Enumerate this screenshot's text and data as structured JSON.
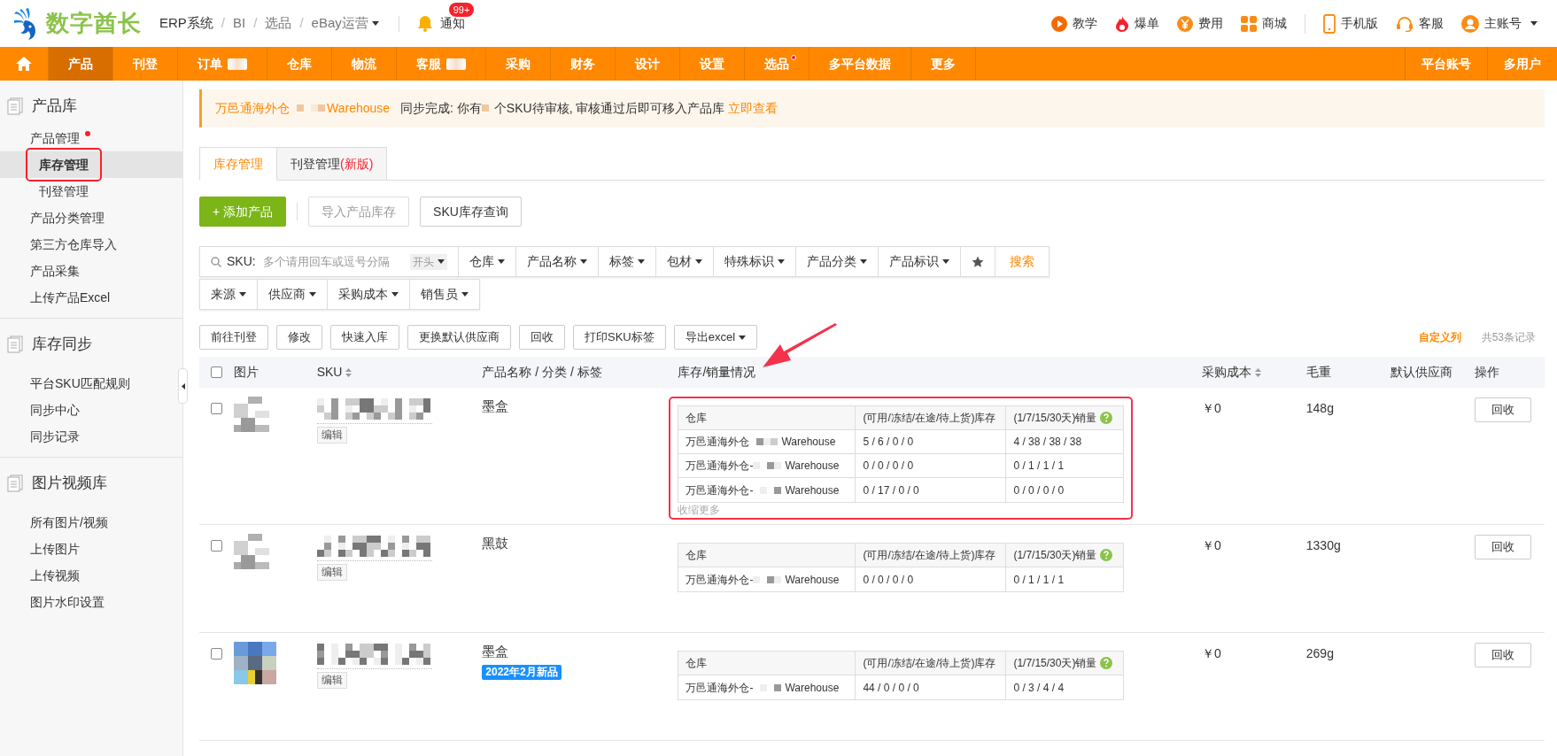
{
  "header": {
    "logo_text": "数字酋长",
    "breadcrumbs": [
      {
        "label": "ERP系统",
        "kind": "link"
      },
      {
        "label": "/",
        "kind": "separator"
      },
      {
        "label": "BI",
        "kind": "link"
      },
      {
        "label": "/",
        "kind": "separator"
      },
      {
        "label": "选品",
        "kind": "link"
      },
      {
        "label": "/",
        "kind": "separator"
      },
      {
        "label": "eBay运营",
        "kind": "link"
      }
    ],
    "notice": "通知",
    "notice_badge": "99+",
    "links": [
      {
        "label": "教学",
        "kind": "play"
      },
      {
        "label": "爆单",
        "kind": "fire"
      },
      {
        "label": "费用",
        "kind": "yen"
      },
      {
        "label": "商城",
        "kind": "grid"
      },
      {
        "label": "手机版",
        "kind": "phone"
      },
      {
        "label": "客服",
        "kind": "headset"
      },
      {
        "label": "主账号",
        "kind": "user"
      }
    ]
  },
  "nav": {
    "items": [
      {
        "label": "产品",
        "selected": true,
        "dot": false,
        "badge": false
      },
      {
        "label": "刊登",
        "selected": false,
        "dot": false,
        "badge": false
      },
      {
        "label": "订单",
        "selected": false,
        "dot": false,
        "badge": true
      },
      {
        "label": "仓库",
        "selected": false,
        "dot": false,
        "badge": false
      },
      {
        "label": "物流",
        "selected": false,
        "dot": false,
        "badge": false
      },
      {
        "label": "客服",
        "selected": false,
        "dot": false,
        "badge": true
      },
      {
        "label": "采购",
        "selected": false,
        "dot": false,
        "badge": false
      },
      {
        "label": "财务",
        "selected": false,
        "dot": false,
        "badge": false
      },
      {
        "label": "设计",
        "selected": false,
        "dot": false,
        "badge": false
      },
      {
        "label": "设置",
        "selected": false,
        "dot": false,
        "badge": false
      },
      {
        "label": "选品",
        "selected": false,
        "dot": true,
        "badge": false
      },
      {
        "label": "多平台数据",
        "selected": false,
        "dot": false,
        "badge": false
      },
      {
        "label": "更多",
        "selected": false,
        "dot": false,
        "badge": false
      }
    ],
    "right_items": [
      "平台账号",
      "多用户"
    ]
  },
  "sidebar": [
    {
      "title": "产品库",
      "items": [
        {
          "label": "产品管理",
          "dot": true,
          "selected": false,
          "highlighted": false,
          "children": [
            {
              "label": "库存管理",
              "dot": false,
              "selected": true,
              "highlighted": true
            },
            {
              "label": "刊登管理",
              "dot": false,
              "selected": false,
              "highlighted": false
            }
          ]
        },
        {
          "label": "产品分类管理",
          "dot": false,
          "selected": false,
          "highlighted": false
        },
        {
          "label": "第三方仓库导入",
          "dot": false,
          "selected": false,
          "highlighted": false
        },
        {
          "label": "产品采集",
          "dot": false,
          "selected": false,
          "highlighted": false
        },
        {
          "label": "上传产品Excel",
          "dot": false,
          "selected": false,
          "highlighted": false
        }
      ]
    },
    {
      "title": "库存同步",
      "items": [
        {
          "label": "平台SKU匹配规则",
          "dot": false,
          "selected": false,
          "highlighted": false
        },
        {
          "label": "同步中心",
          "dot": false,
          "selected": false,
          "highlighted": false
        },
        {
          "label": "同步记录",
          "dot": false,
          "selected": false,
          "highlighted": false
        }
      ]
    },
    {
      "title": "图片视频库",
      "items": [
        {
          "label": "所有图片/视频",
          "dot": false,
          "selected": false,
          "highlighted": false
        },
        {
          "label": "上传图片",
          "dot": false,
          "selected": false,
          "highlighted": false
        },
        {
          "label": "上传视频",
          "dot": false,
          "selected": false,
          "highlighted": false
        },
        {
          "label": "图片水印设置",
          "dot": false,
          "selected": false,
          "highlighted": false
        }
      ]
    }
  ],
  "banner": {
    "warehouse_prefix": "万邑通海外仓",
    "warehouse_suffix": "Warehouse",
    "text_a": "同步完成: 你有",
    "text_b": "个SKU待审核, 审核通过后即可移入产品库",
    "link": "立即查看"
  },
  "tabs": [
    {
      "label": "库存管理",
      "selected": true
    },
    {
      "label": "刊登管理",
      "note": "(新版)",
      "selected": false
    }
  ],
  "top_buttons": [
    {
      "label": "+ 添加产品",
      "kind": "primary"
    },
    {
      "label": "导入产品库存",
      "kind": "disabled"
    },
    {
      "label": "SKU库存查询",
      "kind": "default"
    }
  ],
  "search": {
    "label": "SKU:",
    "placeholder": "多个请用回车或逗号分隔",
    "mode": "开头",
    "button": "搜索"
  },
  "filters_row1": [
    "仓库",
    "产品名称",
    "标签",
    "包材",
    "特殊标识",
    "产品分类",
    "产品标识"
  ],
  "filters_row2": [
    "来源",
    "供应商",
    "采购成本",
    "销售员"
  ],
  "actions": [
    {
      "label": "前往刊登",
      "caret": false
    },
    {
      "label": "修改",
      "caret": false
    },
    {
      "label": "快速入库",
      "caret": false
    },
    {
      "label": "更换默认供应商",
      "caret": false
    },
    {
      "label": "回收",
      "caret": false
    },
    {
      "label": "打印SKU标签",
      "caret": false
    },
    {
      "label": "导出excel",
      "caret": true
    }
  ],
  "custom_columns": "自定义列",
  "record_count": "共53条记录",
  "table": {
    "all_checked": false,
    "columns": [
      {
        "label": "图片",
        "sortable": false
      },
      {
        "label": "SKU",
        "sortable": true
      },
      {
        "label": "产品名称 / 分类 / 标签",
        "sortable": false
      },
      {
        "label": "库存/销量情况",
        "sortable": false
      },
      {
        "label": "采购成本",
        "sortable": true
      },
      {
        "label": "毛重",
        "sortable": false
      },
      {
        "label": "默认供应商",
        "sortable": false
      },
      {
        "label": "操作",
        "sortable": false
      }
    ],
    "rows": [
      {
        "checked": false,
        "name": "墨盒",
        "highlighted": true,
        "edit": "编辑",
        "cost": "￥0",
        "weight": "148g",
        "action": "回收",
        "more": "收缩更多",
        "headers": [
          "仓库",
          "(可用/冻结/在途/待上货)库存",
          "(1/7/15/30天)销量"
        ],
        "stock": [
          {
            "prefix": "万邑通海外仓",
            "suffix": "Warehouse",
            "stock": "5 / 6 / 0 / 0",
            "sales": "4 / 38 / 38 / 38"
          },
          {
            "prefix": "万邑通海外仓-",
            "suffix": "Warehouse",
            "stock": "0 / 0 / 0 / 0",
            "sales": "0 / 1 / 1 / 1"
          },
          {
            "prefix": "万邑通海外仓-",
            "suffix": "Warehouse",
            "stock": "0 / 17 / 0 / 0",
            "sales": "0 / 0 / 0 / 0"
          }
        ]
      },
      {
        "checked": false,
        "name": "黑鼓",
        "highlighted": false,
        "edit": "编辑",
        "cost": "￥0",
        "weight": "1330g",
        "action": "回收",
        "headers": [
          "仓库",
          "(可用/冻结/在途/待上货)库存",
          "(1/7/15/30天)销量"
        ],
        "stock": [
          {
            "prefix": "万邑通海外仓-",
            "suffix": "Warehouse",
            "stock": "0 / 0 / 0 / 0",
            "sales": "0 / 1 / 1 / 1"
          }
        ]
      },
      {
        "checked": false,
        "name": "墨盒",
        "tag": "2022年2月新品",
        "highlighted": false,
        "edit": "编辑",
        "cost": "￥0",
        "weight": "269g",
        "action": "回收",
        "headers": [
          "仓库",
          "(可用/冻结/在途/待上货)库存",
          "(1/7/15/30天)销量"
        ],
        "stock": [
          {
            "prefix": "万邑通海外仓-",
            "suffix": "Warehouse",
            "stock": "44 / 0 / 0 / 0",
            "sales": "0 / 3 / 4 / 4"
          }
        ]
      }
    ]
  }
}
